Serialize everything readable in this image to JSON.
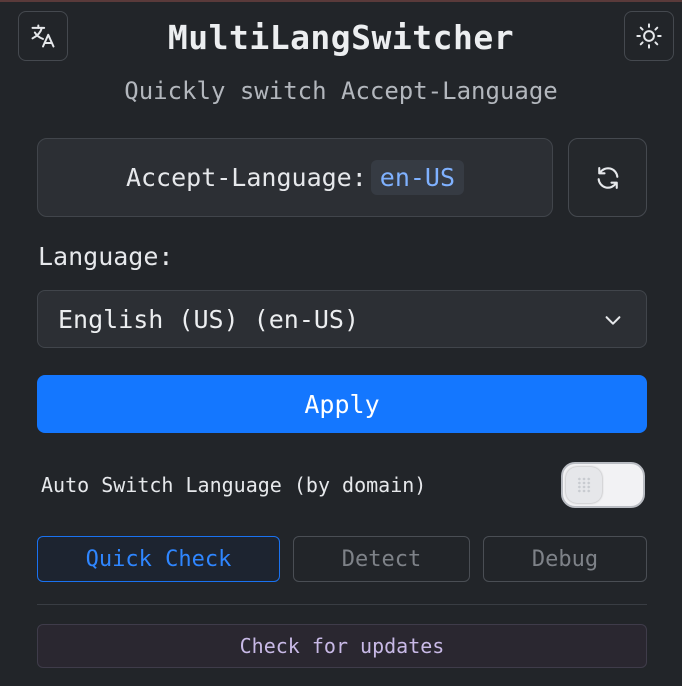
{
  "app": {
    "title": "MultiLangSwitcher",
    "subtitle": "Quickly switch Accept-Language"
  },
  "header_status": {
    "label": "Accept-Language:",
    "value": "en-US"
  },
  "language_select": {
    "label": "Language:",
    "selected": "English (US) (en-US)"
  },
  "actions": {
    "apply_label": "Apply",
    "quick_check_label": "Quick Check",
    "detect_label": "Detect",
    "debug_label": "Debug",
    "check_updates_label": "Check for updates"
  },
  "auto_switch": {
    "label": "Auto Switch Language (by domain)",
    "enabled": false
  },
  "icons": {
    "translate": "translate-icon",
    "theme": "sun-icon",
    "refresh": "refresh-icon",
    "dropdown": "chevron-down-icon"
  },
  "colors": {
    "background": "#222529",
    "accent": "#1477ff",
    "code_text": "#7fb1ff",
    "update_text": "#c8b9e6"
  }
}
